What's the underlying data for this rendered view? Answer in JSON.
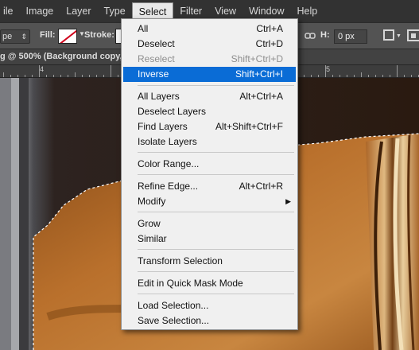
{
  "menubar": {
    "items": [
      {
        "label": "ile"
      },
      {
        "label": "Image"
      },
      {
        "label": "Layer"
      },
      {
        "label": "Type"
      },
      {
        "label": "Select"
      },
      {
        "label": "Filter"
      },
      {
        "label": "View"
      },
      {
        "label": "Window"
      },
      {
        "label": "Help"
      }
    ],
    "active": "Select"
  },
  "options_bar": {
    "shape_mode_value": "pe",
    "fill_label": "Fill:",
    "stroke_label": "Stroke:",
    "h_label": "H:",
    "h_value": "0 px"
  },
  "document": {
    "tab_title": "g @ 500% (Background copy, "
  },
  "ruler": {
    "labels": [
      "4",
      "5"
    ]
  },
  "select_menu": {
    "items": [
      {
        "label": "All",
        "shortcut": "Ctrl+A",
        "state": "normal"
      },
      {
        "label": "Deselect",
        "shortcut": "Ctrl+D",
        "state": "normal"
      },
      {
        "label": "Reselect",
        "shortcut": "Shift+Ctrl+D",
        "state": "disabled"
      },
      {
        "label": "Inverse",
        "shortcut": "Shift+Ctrl+I",
        "state": "highlighted"
      },
      {
        "label": "All Layers",
        "shortcut": "Alt+Ctrl+A",
        "state": "normal"
      },
      {
        "label": "Deselect Layers",
        "shortcut": "",
        "state": "normal"
      },
      {
        "label": "Find Layers",
        "shortcut": "Alt+Shift+Ctrl+F",
        "state": "normal"
      },
      {
        "label": "Isolate Layers",
        "shortcut": "",
        "state": "normal"
      },
      {
        "label": "Color Range...",
        "shortcut": "",
        "state": "normal"
      },
      {
        "label": "Refine Edge...",
        "shortcut": "Alt+Ctrl+R",
        "state": "normal"
      },
      {
        "label": "Modify",
        "shortcut": "",
        "state": "submenu"
      },
      {
        "label": "Grow",
        "shortcut": "",
        "state": "normal"
      },
      {
        "label": "Similar",
        "shortcut": "",
        "state": "normal"
      },
      {
        "label": "Transform Selection",
        "shortcut": "",
        "state": "normal"
      },
      {
        "label": "Edit in Quick Mask Mode",
        "shortcut": "",
        "state": "normal"
      },
      {
        "label": "Load Selection...",
        "shortcut": "",
        "state": "normal"
      },
      {
        "label": "Save Selection...",
        "shortcut": "",
        "state": "normal"
      }
    ],
    "highlight_color": "#0a6cd6"
  },
  "icons": {
    "submenu_arrow": "submenu-arrow-icon",
    "link": "chain-link-icon",
    "path_operations": "path-operations-icon",
    "path_alignment": "path-alignment-icon",
    "fill_swatch": "fill-swatch-icon",
    "stroke_swatch": "stroke-swatch-icon"
  }
}
